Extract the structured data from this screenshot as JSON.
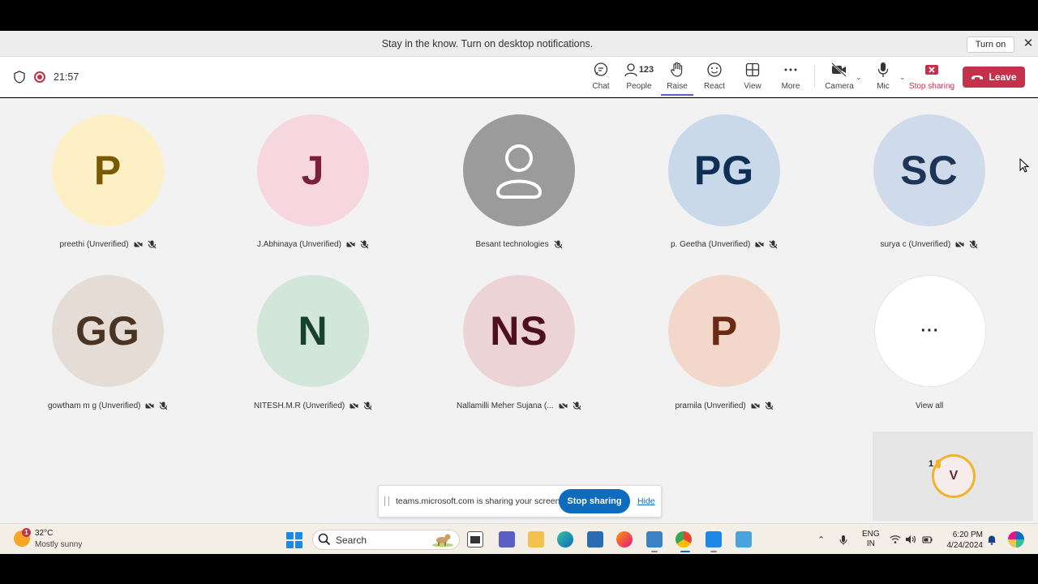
{
  "notification": {
    "text": "Stay in the know. Turn on desktop notifications.",
    "turn_on_label": "Turn on",
    "close_glyph": "✕"
  },
  "meeting": {
    "timer": "21:57",
    "recording": true
  },
  "toolbar": {
    "chat": "Chat",
    "people": "People",
    "people_count": "123",
    "raise": "Raise",
    "react": "React",
    "view": "View",
    "more": "More",
    "camera": "Camera",
    "mic": "Mic",
    "stop_sharing": "Stop sharing",
    "leave": "Leave"
  },
  "participants": [
    {
      "initials": "P",
      "name": "preethi (Unverified)",
      "bg": "#fdf0c7",
      "fg": "#7a5a00"
    },
    {
      "initials": "J",
      "name": "J.Abhinaya (Unverified)",
      "bg": "#f6d6df",
      "fg": "#7b1f3a"
    },
    {
      "initials": "",
      "name": "Besant technologies",
      "bg": "#9b9b9b",
      "fg": "#ffffff"
    },
    {
      "initials": "PG",
      "name": "p. Geetha (Unverified)",
      "bg": "#c9d9ea",
      "fg": "#0f2f57"
    },
    {
      "initials": "SC",
      "name": "surya c (Unverified)",
      "bg": "#cfdbea",
      "fg": "#1d3658"
    },
    {
      "initials": "GG",
      "name": "gowtham m g (Unverified)",
      "bg": "#e5ddd5",
      "fg": "#4a3525"
    },
    {
      "initials": "N",
      "name": "NITESH.M.R (Unverified)",
      "bg": "#d2e6da",
      "fg": "#17432b"
    },
    {
      "initials": "NS",
      "name": "Nallamilli Meher Sujana (...",
      "bg": "#ecd3d6",
      "fg": "#4e1020"
    },
    {
      "initials": "P",
      "name": "pramila (Unverified)",
      "bg": "#f3d7ca",
      "fg": "#6b2a14"
    }
  ],
  "view_all": {
    "label": "View all",
    "glyph": "···"
  },
  "self_view": {
    "initial": "V",
    "raised_hand_count": "1"
  },
  "share_bar": {
    "text": "teams.microsoft.com is sharing your screen.",
    "stop_label": "Stop sharing",
    "hide_label": "Hide"
  },
  "taskbar": {
    "weather_temp": "32°C",
    "weather_desc": "Mostly sunny",
    "weather_badge": "1",
    "search_label": "Search",
    "lang_line1": "ENG",
    "lang_line2": "IN",
    "time": "6:20 PM",
    "date": "4/24/2024"
  },
  "colors": {
    "accent": "#5b5fc7",
    "leave": "#c4314b",
    "share_blue": "#0f6cbd"
  }
}
